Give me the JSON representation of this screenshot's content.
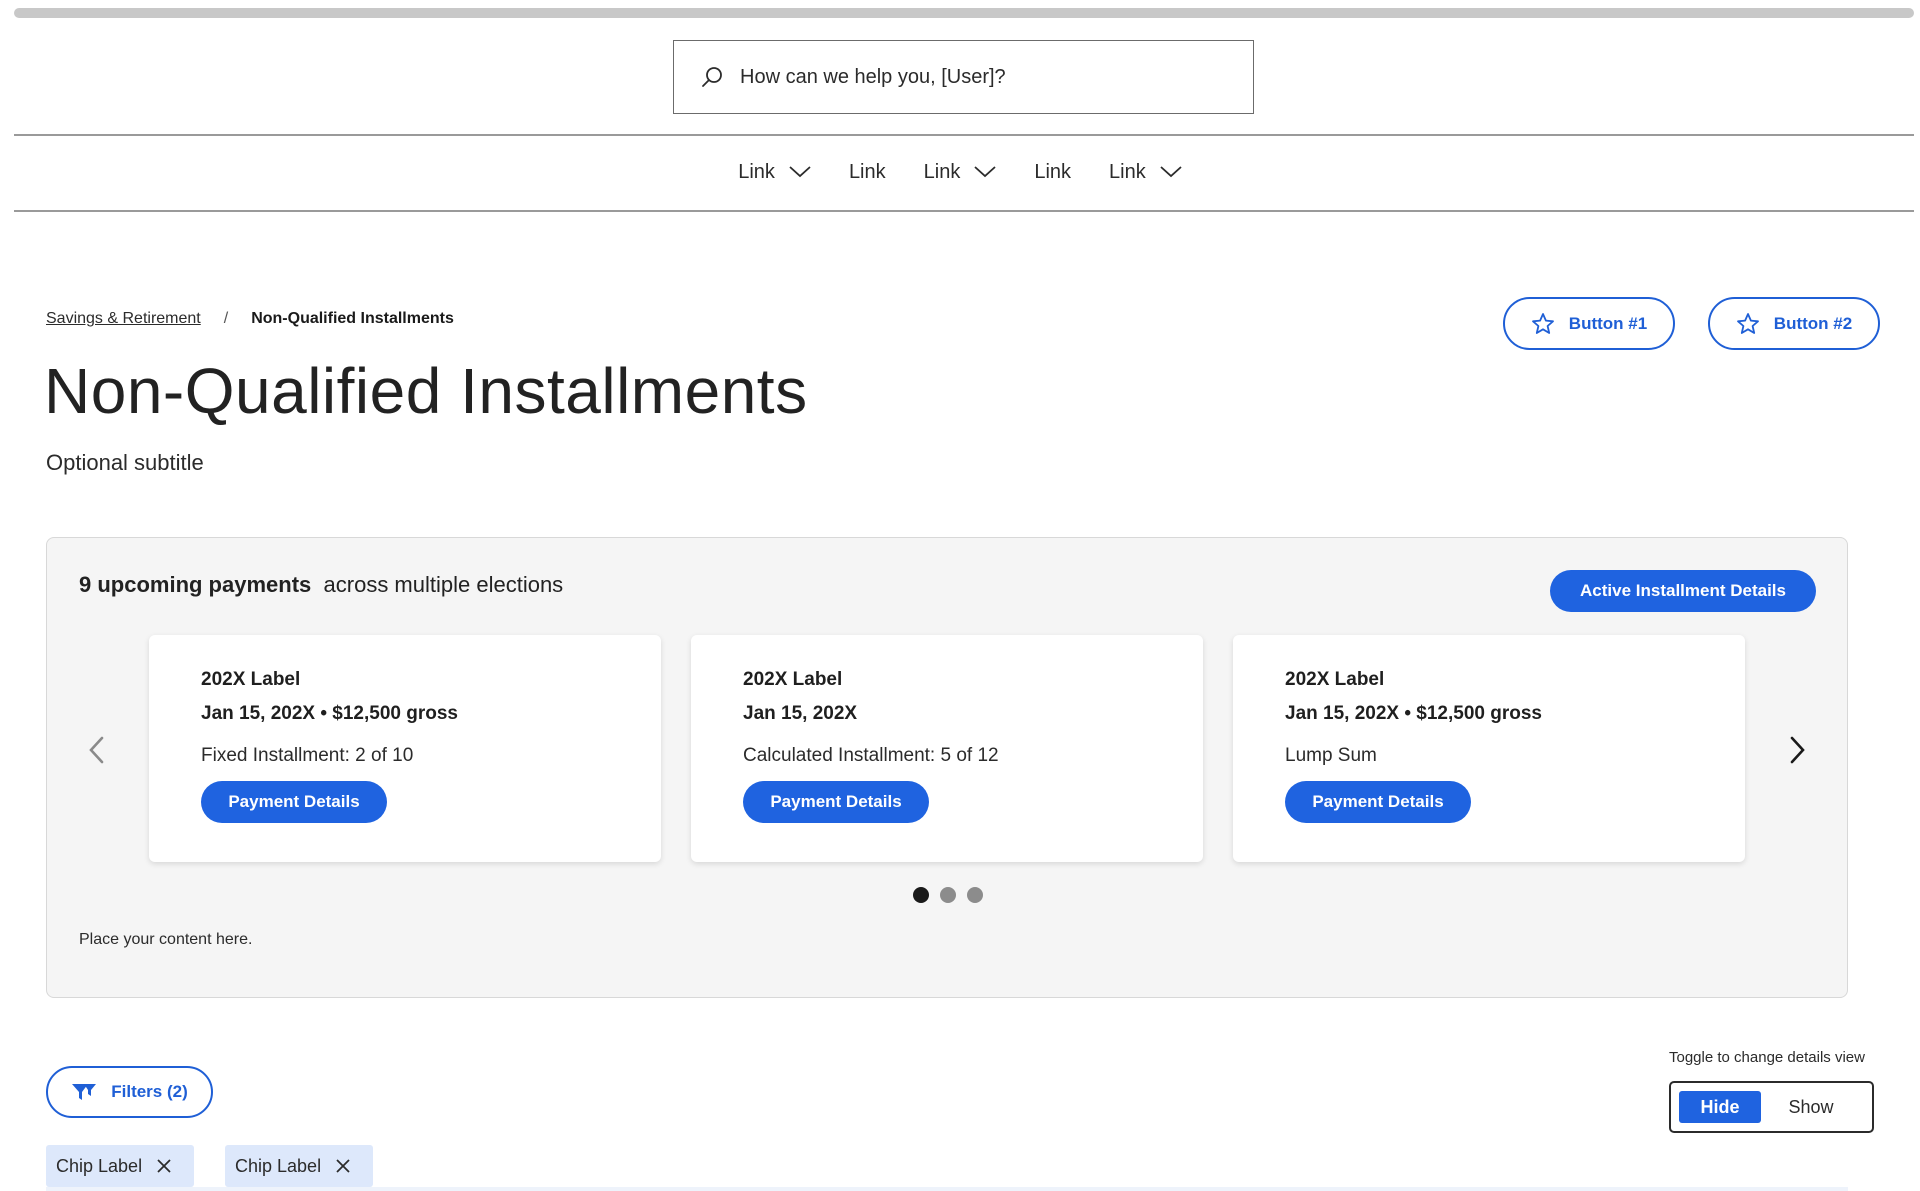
{
  "search": {
    "placeholder": "How can we help you, [User]?"
  },
  "nav": [
    {
      "label": "Link",
      "has_dropdown": true
    },
    {
      "label": "Link",
      "has_dropdown": false
    },
    {
      "label": "Link",
      "has_dropdown": true
    },
    {
      "label": "Link",
      "has_dropdown": false
    },
    {
      "label": "Link",
      "has_dropdown": true
    }
  ],
  "breadcrumb": {
    "parent": "Savings & Retirement",
    "separator": "/",
    "current": "Non-Qualified Installments"
  },
  "header_buttons": {
    "button1": "Button #1",
    "button2": "Button #2",
    "icon": "star-icon"
  },
  "page": {
    "title": "Non-Qualified Installments",
    "subtitle": "Optional subtitle"
  },
  "panel": {
    "summary_bold": "9 upcoming payments",
    "summary_rest": "across multiple elections",
    "active_button": "Active Installment Details",
    "cards": [
      {
        "label": "202X Label",
        "date_line": "Jan 15, 202X • $12,500 gross",
        "type": "Fixed Installment: 2 of 10",
        "button": "Payment Details"
      },
      {
        "label": "202X Label",
        "date_line": "Jan 15, 202X",
        "type": "Calculated Installment: 5 of 12",
        "button": "Payment Details"
      },
      {
        "label": "202X Label",
        "date_line": "Jan 15, 202X • $12,500 gross",
        "type": "Lump Sum",
        "button": "Payment Details"
      }
    ],
    "carousel": {
      "pages": 3,
      "active_page": 1
    },
    "placeholder": "Place your content here."
  },
  "filters": {
    "label": "Filters (2)",
    "icon": "filter-icon"
  },
  "toggle": {
    "caption": "Toggle to change details view",
    "options": [
      "Hide",
      "Show"
    ],
    "selected": "Hide"
  },
  "chips": [
    {
      "label": "Chip Label"
    },
    {
      "label": "Chip Label"
    }
  ],
  "colors": {
    "accent": "#1f63e0",
    "chip_bg": "#dde8fb",
    "panel_bg": "#f5f5f5"
  }
}
